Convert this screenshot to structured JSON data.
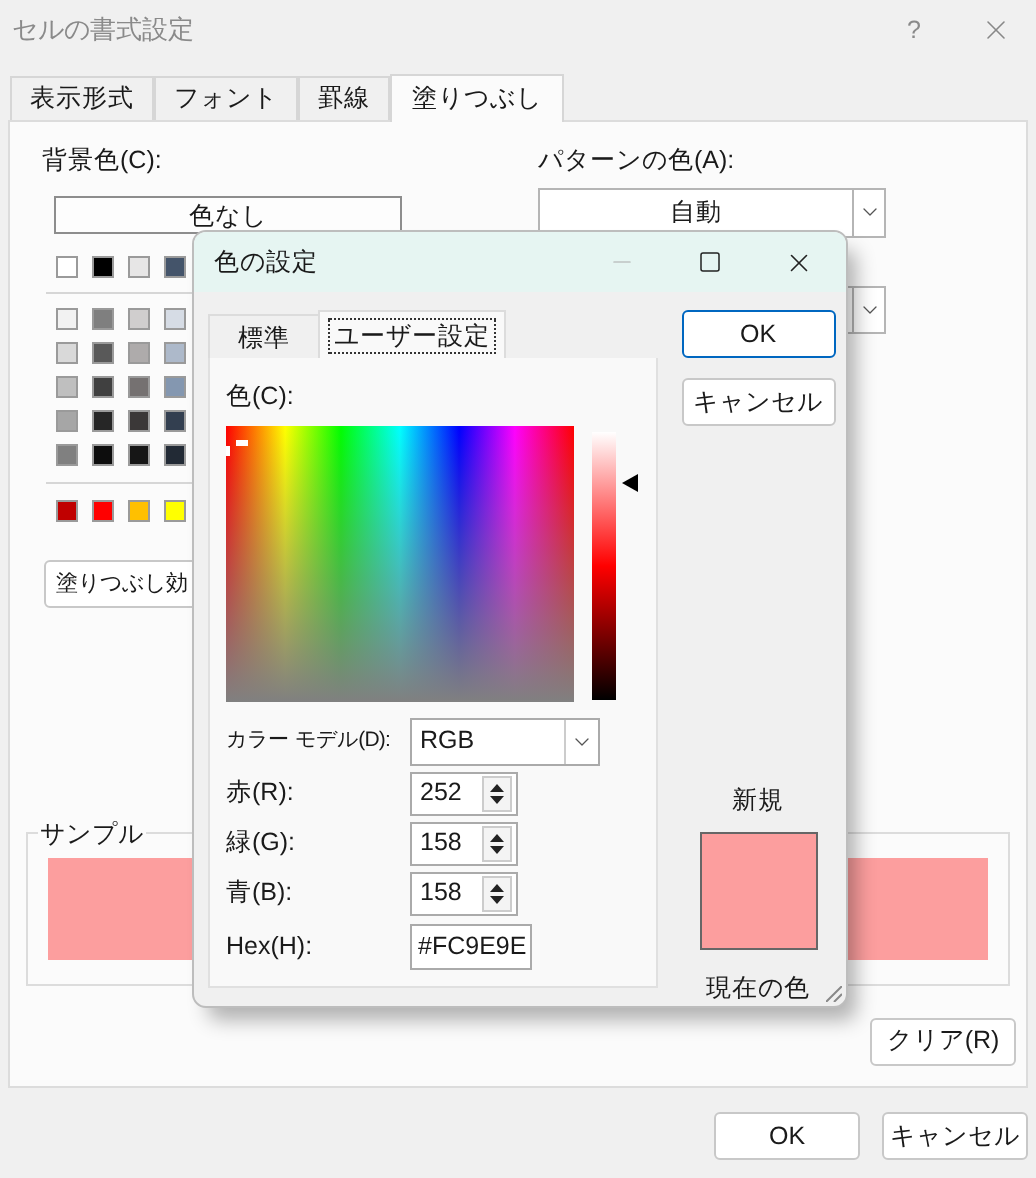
{
  "window": {
    "title": "セルの書式設定",
    "help": "?"
  },
  "tabs": [
    {
      "label": "表示形式",
      "selected": false
    },
    {
      "label": "フォント",
      "selected": false
    },
    {
      "label": "罫線",
      "selected": false
    },
    {
      "label": "塗りつぶし",
      "selected": true
    }
  ],
  "background_color": {
    "label": "背景色(C):",
    "no_color_button": "色なし",
    "top_swatches": [
      {
        "color": "#ffffff"
      },
      {
        "color": "#000000"
      },
      {
        "color": "#e7e6e6"
      },
      {
        "color": "#44546a"
      }
    ],
    "swatch_rows": [
      [
        {
          "color": "#f2f2f2"
        },
        {
          "color": "#7f7f7f"
        },
        {
          "color": "#d0cece"
        },
        {
          "color": "#d6dce5"
        }
      ],
      [
        {
          "color": "#d9d9d9"
        },
        {
          "color": "#595959"
        },
        {
          "color": "#aeabab"
        },
        {
          "color": "#adb9ca"
        }
      ],
      [
        {
          "color": "#bfbfbf"
        },
        {
          "color": "#404040"
        },
        {
          "color": "#757171"
        },
        {
          "color": "#8497b0"
        }
      ],
      [
        {
          "color": "#a6a6a6"
        },
        {
          "color": "#262626"
        },
        {
          "color": "#3b3838"
        },
        {
          "color": "#333f50"
        }
      ],
      [
        {
          "color": "#808080"
        },
        {
          "color": "#0d0d0d"
        },
        {
          "color": "#161616"
        },
        {
          "color": "#222a35"
        }
      ]
    ],
    "standard_swatches": [
      {
        "color": "#c00000"
      },
      {
        "color": "#ff0000"
      },
      {
        "color": "#ffc000"
      },
      {
        "color": "#ffff00"
      }
    ],
    "effects_button": "塗りつぶし効"
  },
  "pattern_color": {
    "label": "パターンの色(A):",
    "value": "自動"
  },
  "sample": {
    "label": "サンプル",
    "color": "#fc9e9e"
  },
  "clear_button": "クリア(R)",
  "buttons": [
    "OK",
    "キャンセル"
  ],
  "color_dialog": {
    "title": "色の設定",
    "tabs": [
      {
        "label": "標準",
        "selected": false
      },
      {
        "label": "ユーザー設定",
        "selected": true
      }
    ],
    "color_label": "色(C):",
    "luminance": {
      "level": 0.81
    },
    "model": {
      "label": "カラー モデル(D):",
      "value": "RGB"
    },
    "channels": [
      {
        "label": "赤(R):",
        "value": "252"
      },
      {
        "label": "緑(G):",
        "value": "158"
      },
      {
        "label": "青(B):",
        "value": "158"
      }
    ],
    "hex": {
      "label": "Hex(H):",
      "value": "#FC9E9E"
    },
    "ok_button": "OK",
    "cancel_button": "キャンセル",
    "new_label": "新規",
    "preview": {
      "color": "#fc9e9e"
    },
    "current_label": "現在の色"
  }
}
